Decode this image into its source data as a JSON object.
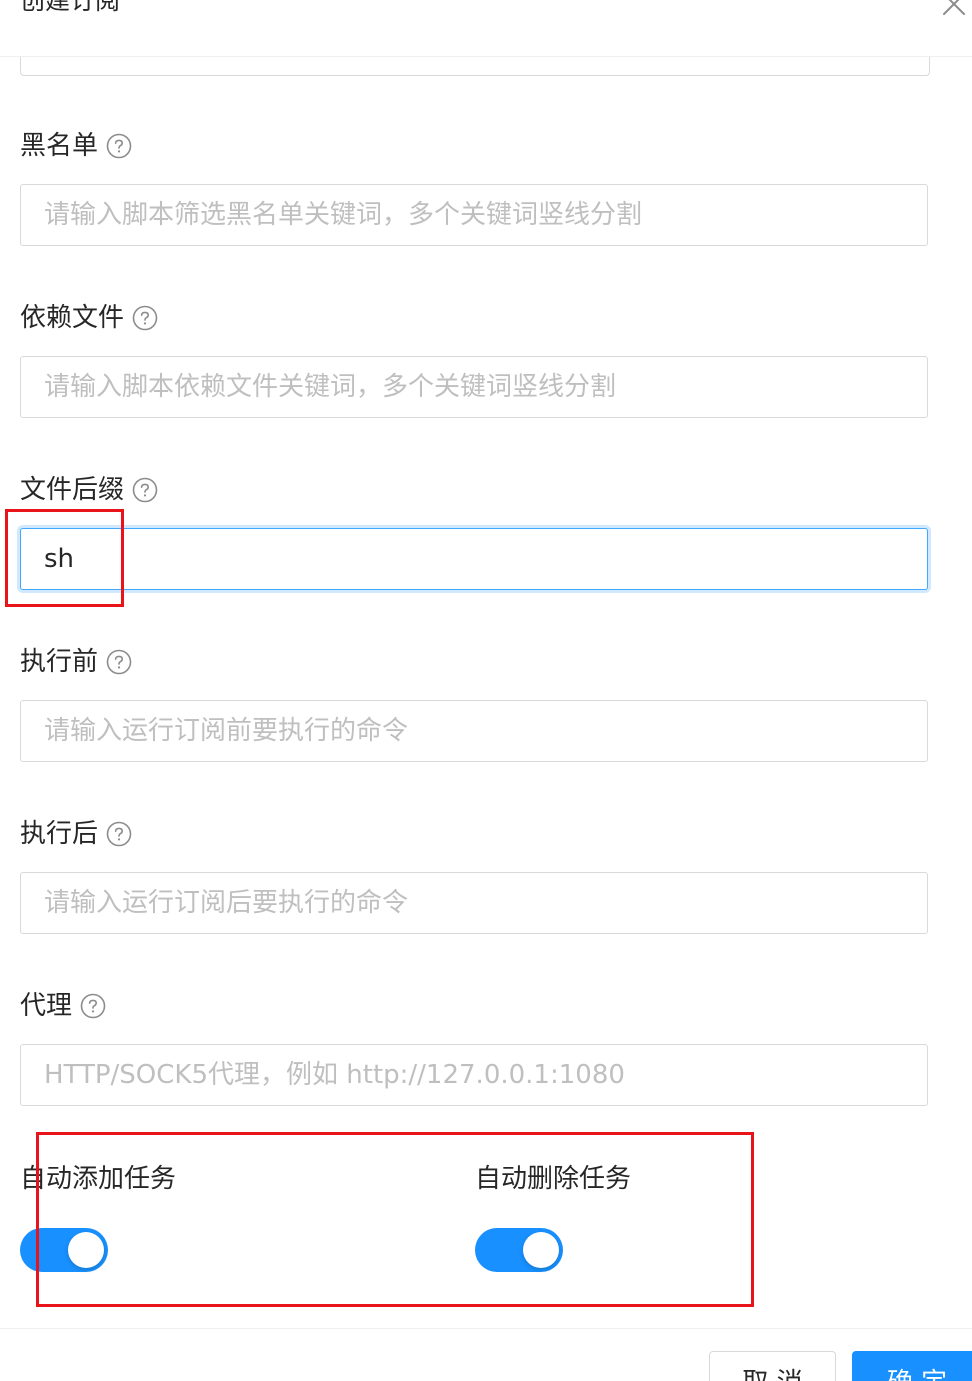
{
  "modal": {
    "title": "创建订阅"
  },
  "fields": {
    "blacklist": {
      "label": "黑名单",
      "placeholder": "请输入脚本筛选黑名单关键词，多个关键词竖线分割",
      "value": ""
    },
    "dependence": {
      "label": "依赖文件",
      "placeholder": "请输入脚本依赖文件关键词，多个关键词竖线分割",
      "value": ""
    },
    "extensions": {
      "label": "文件后缀",
      "placeholder": "",
      "value": "sh"
    },
    "sub_before": {
      "label": "执行前",
      "placeholder": "请输入运行订阅前要执行的命令",
      "value": ""
    },
    "sub_after": {
      "label": "执行后",
      "placeholder": "请输入运行订阅后要执行的命令",
      "value": ""
    },
    "proxy": {
      "label": "代理",
      "placeholder": "HTTP/SOCK5代理，例如 http://127.0.0.1:1080",
      "value": ""
    }
  },
  "switches": {
    "auto_add": {
      "label": "自动添加任务",
      "checked": true
    },
    "auto_del": {
      "label": "自动删除任务",
      "checked": true
    }
  },
  "footer": {
    "cancel_label": "取 消",
    "ok_label": "确 定"
  },
  "icons": {
    "help": "question-circle-icon",
    "close": "close-icon"
  },
  "colors": {
    "primary": "#1890ff",
    "focus_border": "#40a9ff",
    "annotation": "#e8141a",
    "placeholder": "#bfbfbf"
  }
}
